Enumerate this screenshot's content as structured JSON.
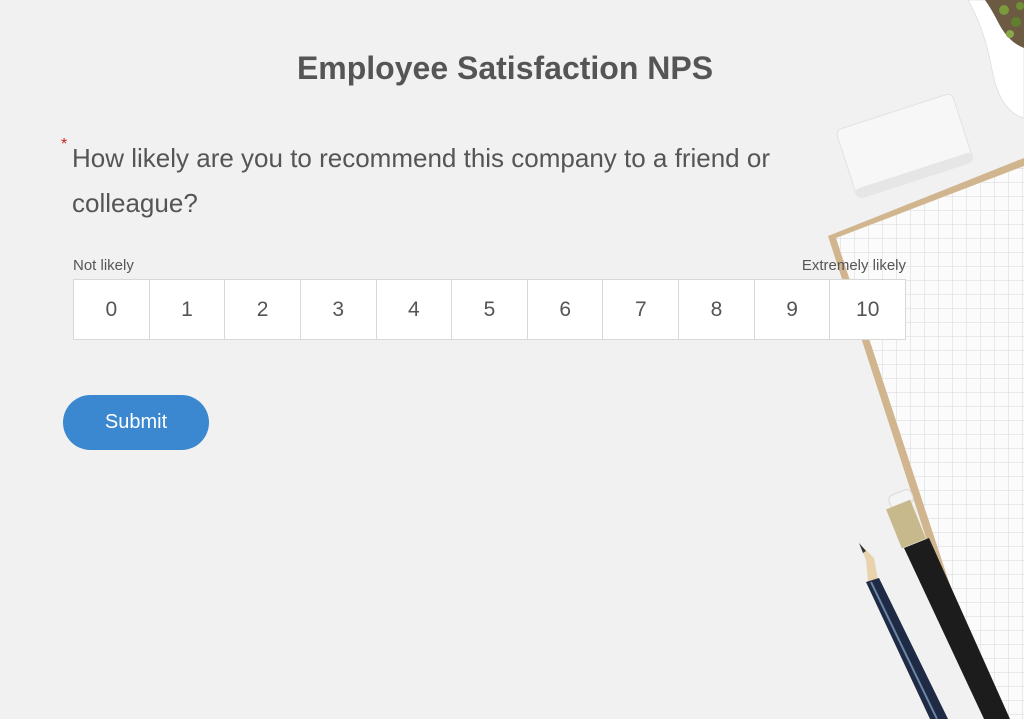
{
  "form": {
    "title": "Employee Satisfaction NPS",
    "required_marker": "*",
    "question": "How likely are you to recommend this company to a friend or colleague?",
    "low_label": "Not likely",
    "high_label": "Extremely likely",
    "options": [
      "0",
      "1",
      "2",
      "3",
      "4",
      "5",
      "6",
      "7",
      "8",
      "9",
      "10"
    ],
    "submit_label": "Submit"
  },
  "colors": {
    "background": "#f1f1f1",
    "text": "#555555",
    "required": "#cc2222",
    "submit_button": "#3b87d0",
    "scale_border": "#d8d8d8"
  },
  "background_image": {
    "items": [
      "potted-plant-image",
      "eraser-image",
      "grid-notebook-image",
      "pencil-image",
      "pen-image"
    ]
  }
}
